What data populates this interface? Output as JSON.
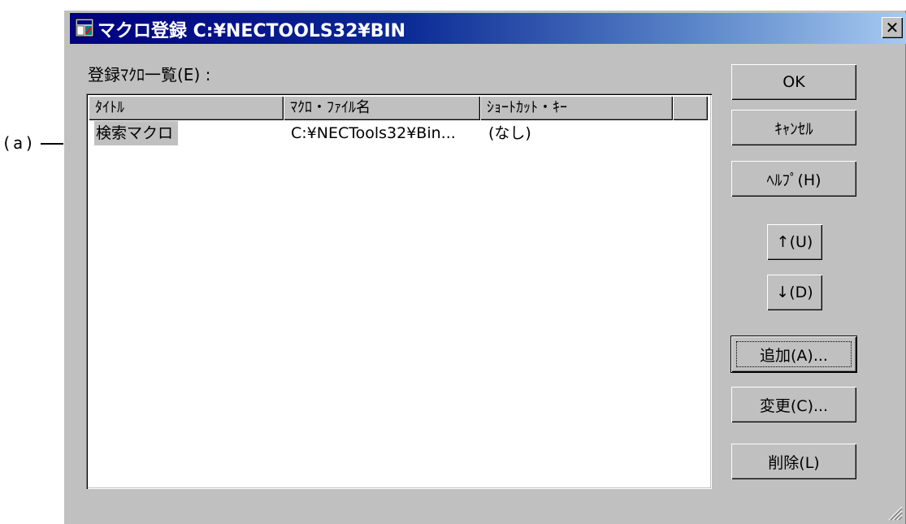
{
  "annotation": {
    "label": "(a)"
  },
  "window": {
    "title": "マクロ登録 C:¥NECTOOLS32¥BIN",
    "close_glyph": "✕"
  },
  "list": {
    "label": "登録ﾏｸﾛ一覧(E) :",
    "columns": [
      "ﾀｲﾄﾙ",
      "ﾏｸﾛ・ﾌｧｲﾙ名",
      "ｼｮｰﾄｶｯﾄ・ｷｰ",
      ""
    ],
    "rows": [
      {
        "title": "検索マクロ",
        "file": "C:¥NECTools32¥Bin...",
        "shortcut": "(なし)"
      }
    ]
  },
  "buttons": {
    "ok": "OK",
    "cancel": "ｷｬﾝｾﾙ",
    "help": "ﾍﾙﾌﾟ(H)",
    "up": "↑(U)",
    "down": "↓(D)",
    "add": "追加(A)...",
    "change": "変更(C)...",
    "delete": "削除(L)"
  },
  "colors": {
    "title_gradient_start": "#000080",
    "title_gradient_end": "#a6caf0",
    "face": "#c0c0c0",
    "selection": "#c0c0c0"
  },
  "icons": [
    "app-icon",
    "close-icon",
    "size-grip-icon",
    "arrow-icon"
  ]
}
